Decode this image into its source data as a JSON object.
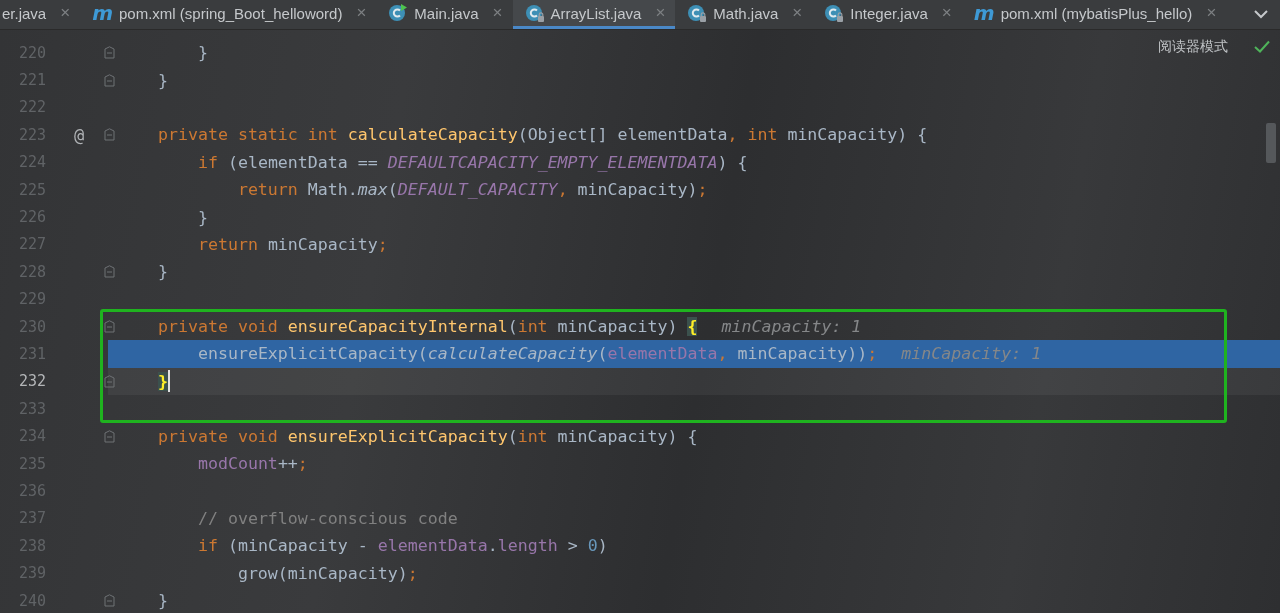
{
  "tabs": [
    {
      "label": "er.java",
      "kind": "cut",
      "close": "×",
      "selected": false
    },
    {
      "label": "pom.xml (spring_Boot_helloword)",
      "kind": "maven",
      "icon_glyph": "m",
      "close": "×",
      "selected": false
    },
    {
      "label": "Main.java",
      "kind": "run-class",
      "close": "×",
      "selected": false
    },
    {
      "label": "ArrayList.java",
      "kind": "locked-class",
      "close": "×",
      "selected": true
    },
    {
      "label": "Math.java",
      "kind": "locked-class",
      "close": "×",
      "selected": false
    },
    {
      "label": "Integer.java",
      "kind": "locked-class",
      "close": "×",
      "selected": false
    },
    {
      "label": "pom.xml (mybatisPlus_hello)",
      "kind": "maven",
      "icon_glyph": "m",
      "close": "×",
      "selected": false
    }
  ],
  "editor": {
    "reader_mode_label": "阅读器模式",
    "sections": [
      {
        "boxed": false,
        "lines": [
          {
            "number": "220",
            "fold": true,
            "selected": false,
            "caret": false,
            "tokens": [
              {
                "text": "        }",
                "kind": "plain"
              }
            ]
          },
          {
            "number": "221",
            "fold": true,
            "selected": false,
            "caret": false,
            "tokens": [
              {
                "text": "    }",
                "kind": "plain"
              }
            ]
          },
          {
            "number": "222",
            "fold": false,
            "selected": false,
            "caret": false
          },
          {
            "number": "223",
            "gutter_mark": "@",
            "fold": true,
            "selected": false,
            "caret": false,
            "tokens": [
              {
                "text": "    private static int ",
                "kind": "keyword"
              },
              {
                "text": "calculateCapacity",
                "kind": "declaration"
              },
              {
                "text": "(Object[] elementData",
                "kind": "plain"
              },
              {
                "text": ", ",
                "kind": "punct"
              },
              {
                "text": "int ",
                "kind": "keyword"
              },
              {
                "text": "minCapacity) {",
                "kind": "plain"
              }
            ]
          },
          {
            "number": "224",
            "fold": false,
            "selected": false,
            "caret": false,
            "tokens": [
              {
                "text": "        if",
                "kind": "keyword"
              },
              {
                "text": " (elementData == ",
                "kind": "plain"
              },
              {
                "text": "DEFAULTCAPACITY_EMPTY_ELEMENTDATA",
                "kind": "constant"
              },
              {
                "text": ") {",
                "kind": "plain"
              }
            ]
          },
          {
            "number": "225",
            "fold": false,
            "selected": false,
            "caret": false,
            "tokens": [
              {
                "text": "            return ",
                "kind": "keyword"
              },
              {
                "text": "Math.",
                "kind": "plain"
              },
              {
                "text": "max",
                "kind": "static-call"
              },
              {
                "text": "(",
                "kind": "plain"
              },
              {
                "text": "DEFAULT_CAPACITY",
                "kind": "constant"
              },
              {
                "text": ", ",
                "kind": "punct"
              },
              {
                "text": "minCapacity)",
                "kind": "plain"
              },
              {
                "text": ";",
                "kind": "punct"
              }
            ]
          },
          {
            "number": "226",
            "fold": false,
            "selected": false,
            "caret": false,
            "tokens": [
              {
                "text": "        }",
                "kind": "plain"
              }
            ]
          },
          {
            "number": "227",
            "fold": false,
            "selected": false,
            "caret": false,
            "tokens": [
              {
                "text": "        return ",
                "kind": "keyword"
              },
              {
                "text": "minCapacity",
                "kind": "plain"
              },
              {
                "text": ";",
                "kind": "punct"
              }
            ]
          },
          {
            "number": "228",
            "fold": true,
            "selected": false,
            "caret": false,
            "tokens": [
              {
                "text": "    }",
                "kind": "plain"
              }
            ]
          },
          {
            "number": "229",
            "fold": false,
            "selected": false,
            "caret": false
          }
        ]
      },
      {
        "boxed": true,
        "lines": [
          {
            "number": "230",
            "fold": true,
            "selected": false,
            "caret": false,
            "tokens": [
              {
                "text": "    private void ",
                "kind": "keyword"
              },
              {
                "text": "ensureCapacityInternal",
                "kind": "declaration"
              },
              {
                "text": "(",
                "kind": "plain"
              },
              {
                "text": "int ",
                "kind": "keyword"
              },
              {
                "text": "minCapacity) ",
                "kind": "plain"
              },
              {
                "text": "{",
                "kind": "brace-match"
              }
            ],
            "hint": "minCapacity: 1"
          },
          {
            "number": "231",
            "fold": false,
            "selected": true,
            "caret": false,
            "tokens": [
              {
                "text": "        ensureExplicitCapacity(",
                "kind": "plain"
              },
              {
                "text": "calculateCapacity",
                "kind": "static-call"
              },
              {
                "text": "(",
                "kind": "plain"
              },
              {
                "text": "elementData",
                "kind": "field"
              },
              {
                "text": ", ",
                "kind": "punct"
              },
              {
                "text": "minCapacity))",
                "kind": "plain"
              },
              {
                "text": ";",
                "kind": "punct"
              }
            ],
            "hint": "minCapacity: 1"
          },
          {
            "number": "232",
            "fold": true,
            "selected": false,
            "caret": true,
            "tokens": [
              {
                "text": "    }",
                "kind": "brace-match"
              }
            ]
          },
          {
            "number": "233",
            "fold": false,
            "selected": false,
            "caret": false
          }
        ]
      },
      {
        "boxed": false,
        "lines": [
          {
            "number": "234",
            "fold": true,
            "selected": false,
            "caret": false,
            "tokens": [
              {
                "text": "    private void ",
                "kind": "keyword"
              },
              {
                "text": "ensureExplicitCapacity",
                "kind": "declaration"
              },
              {
                "text": "(",
                "kind": "plain"
              },
              {
                "text": "int ",
                "kind": "keyword"
              },
              {
                "text": "minCapacity) {",
                "kind": "plain"
              }
            ]
          },
          {
            "number": "235",
            "fold": false,
            "selected": false,
            "caret": false,
            "tokens": [
              {
                "text": "        modCount",
                "kind": "field"
              },
              {
                "text": "++",
                "kind": "plain"
              },
              {
                "text": ";",
                "kind": "punct"
              }
            ]
          },
          {
            "number": "236",
            "fold": false,
            "selected": false,
            "caret": false
          },
          {
            "number": "237",
            "fold": false,
            "selected": false,
            "caret": false,
            "tokens": [
              {
                "text": "        // overflow-conscious code",
                "kind": "comment"
              }
            ]
          },
          {
            "number": "238",
            "fold": false,
            "selected": false,
            "caret": false,
            "tokens": [
              {
                "text": "        if",
                "kind": "keyword"
              },
              {
                "text": " (minCapacity - ",
                "kind": "plain"
              },
              {
                "text": "elementData",
                "kind": "field"
              },
              {
                "text": ".",
                "kind": "plain"
              },
              {
                "text": "length",
                "kind": "field"
              },
              {
                "text": " > ",
                "kind": "plain"
              },
              {
                "text": "0",
                "kind": "number"
              },
              {
                "text": ")",
                "kind": "plain"
              }
            ]
          },
          {
            "number": "239",
            "fold": false,
            "selected": false,
            "caret": false,
            "tokens": [
              {
                "text": "            grow(minCapacity)",
                "kind": "plain"
              },
              {
                "text": ";",
                "kind": "punct"
              }
            ]
          },
          {
            "number": "240",
            "fold": true,
            "selected": false,
            "caret": false,
            "tokens": [
              {
                "text": "    }",
                "kind": "plain"
              }
            ]
          }
        ]
      }
    ]
  }
}
